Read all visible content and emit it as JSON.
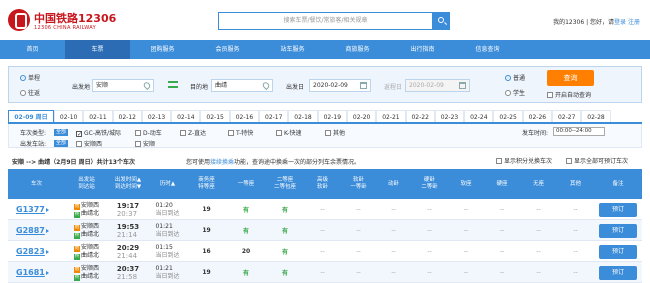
{
  "header": {
    "brand": "中国铁路12306",
    "brand_en": "12306 CHINA RAILWAY",
    "search_placeholder": "搜索车票/餐饮/常旅客/相关规章",
    "my12306": "我的12306",
    "greeting": "您好，请",
    "login": "登录",
    "register": "注册"
  },
  "nav": [
    "首页",
    "车票",
    "团购服务",
    "会员服务",
    "站车服务",
    "商旅服务",
    "出行指南",
    "信息查询"
  ],
  "nav_active": 1,
  "query": {
    "trip_oneway": "单程",
    "trip_round": "往返",
    "from_label": "出发地",
    "from_value": "安顺",
    "to_label": "目的地",
    "to_value": "曲靖",
    "depart_label": "出发日",
    "depart_value": "2020-02-09",
    "return_label": "返程日",
    "return_value": "2020-02-09",
    "type_normal": "普通",
    "type_student": "学生",
    "search_button": "查询",
    "auto_query": "开启自动查询"
  },
  "dates": {
    "active": "02-09 周日",
    "items": [
      "02-10",
      "02-11",
      "02-12",
      "02-13",
      "02-14",
      "02-15",
      "02-16",
      "02-17",
      "02-18",
      "02-19",
      "02-20",
      "02-21",
      "02-22",
      "02-23",
      "02-24",
      "02-25",
      "02-26",
      "02-27",
      "02-28"
    ]
  },
  "filter": {
    "train_type_label": "车次类型:",
    "all": "全部",
    "types": [
      "GC-高铁/城际",
      "D-动车",
      "Z-直达",
      "T-特快",
      "K-快速",
      "其他"
    ],
    "depart_station_label": "出发车站:",
    "stations": [
      "安顺西",
      "安顺"
    ],
    "time_label": "发车时间:",
    "time_value": "00:00--24:00"
  },
  "summary": {
    "route": "安顺 --> 曲靖（2月9日 周日）共计13个车次",
    "tip_pre": "您可使用",
    "tip_link": "接续换乘",
    "tip_post": "功能，查询途中换乘一次的部分列车余票情况。",
    "show_points": "显示积分兑换车次",
    "show_all": "显示全部可预订车次"
  },
  "columns": [
    "车次",
    "出发站\n到达站",
    "出发时间▲\n到达时间▼",
    "历时▲",
    "商务座\n特等座",
    "一等座",
    "二等座\n二等包座",
    "高级\n软卧",
    "软卧\n一等卧",
    "动卧",
    "硬卧\n二等卧",
    "软座",
    "硬座",
    "无座",
    "其他",
    "备注"
  ],
  "trains": [
    {
      "code": "G1377",
      "from": "安顺西",
      "to": "曲靖北",
      "dep": "19:17",
      "arr": "20:37",
      "dur": "01:20",
      "day": "当日到达",
      "biz": "19",
      "first": "有",
      "second": "有",
      "book": "预订"
    },
    {
      "code": "G2887",
      "from": "安顺西",
      "to": "曲靖北",
      "dep": "19:53",
      "arr": "21:14",
      "dur": "01:21",
      "day": "当日到达",
      "biz": "19",
      "first": "有",
      "second": "有",
      "book": "预订"
    },
    {
      "code": "G2823",
      "from": "安顺西",
      "to": "曲靖北",
      "dep": "20:29",
      "arr": "21:44",
      "dur": "01:15",
      "day": "当日到达",
      "biz": "16",
      "first": "20",
      "second": "有",
      "book": "预订"
    },
    {
      "code": "G1681",
      "from": "安顺西",
      "to": "曲靖北",
      "dep": "20:37",
      "arr": "21:58",
      "dur": "01:21",
      "day": "当日到达",
      "biz": "19",
      "first": "有",
      "second": "有",
      "book": "预订"
    }
  ],
  "dash": "--",
  "icons": {
    "start": "始",
    "pass": "过",
    "end": "终"
  },
  "colors": {
    "primary": "#3b8cd9",
    "orange": "#ff8000",
    "green": "#3aab4a",
    "red": "#c8161d"
  }
}
